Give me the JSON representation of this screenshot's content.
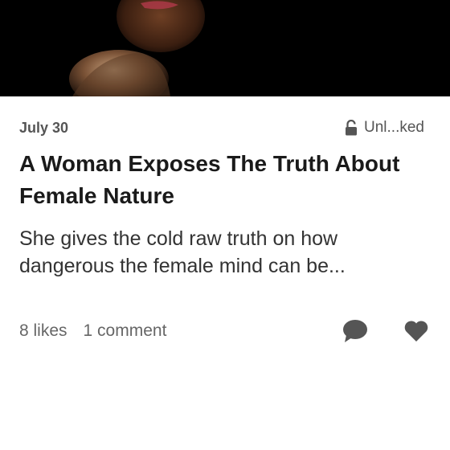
{
  "post": {
    "date": "July 30",
    "lock_status": "Unl...ked",
    "title": "A Woman Exposes The Truth About Female Nature",
    "subtitle": "She gives the cold raw truth on how dangerous the female mind can be...",
    "likes": "8 likes",
    "comments": "1 comment"
  },
  "icons": {
    "lock": "unlocked-lock-icon",
    "comment": "comment-bubble-icon",
    "like": "heart-icon"
  },
  "colors": {
    "hero_background": "#000000",
    "text_primary": "#1a1a1a",
    "text_secondary": "#555555",
    "icon": "#555555"
  }
}
